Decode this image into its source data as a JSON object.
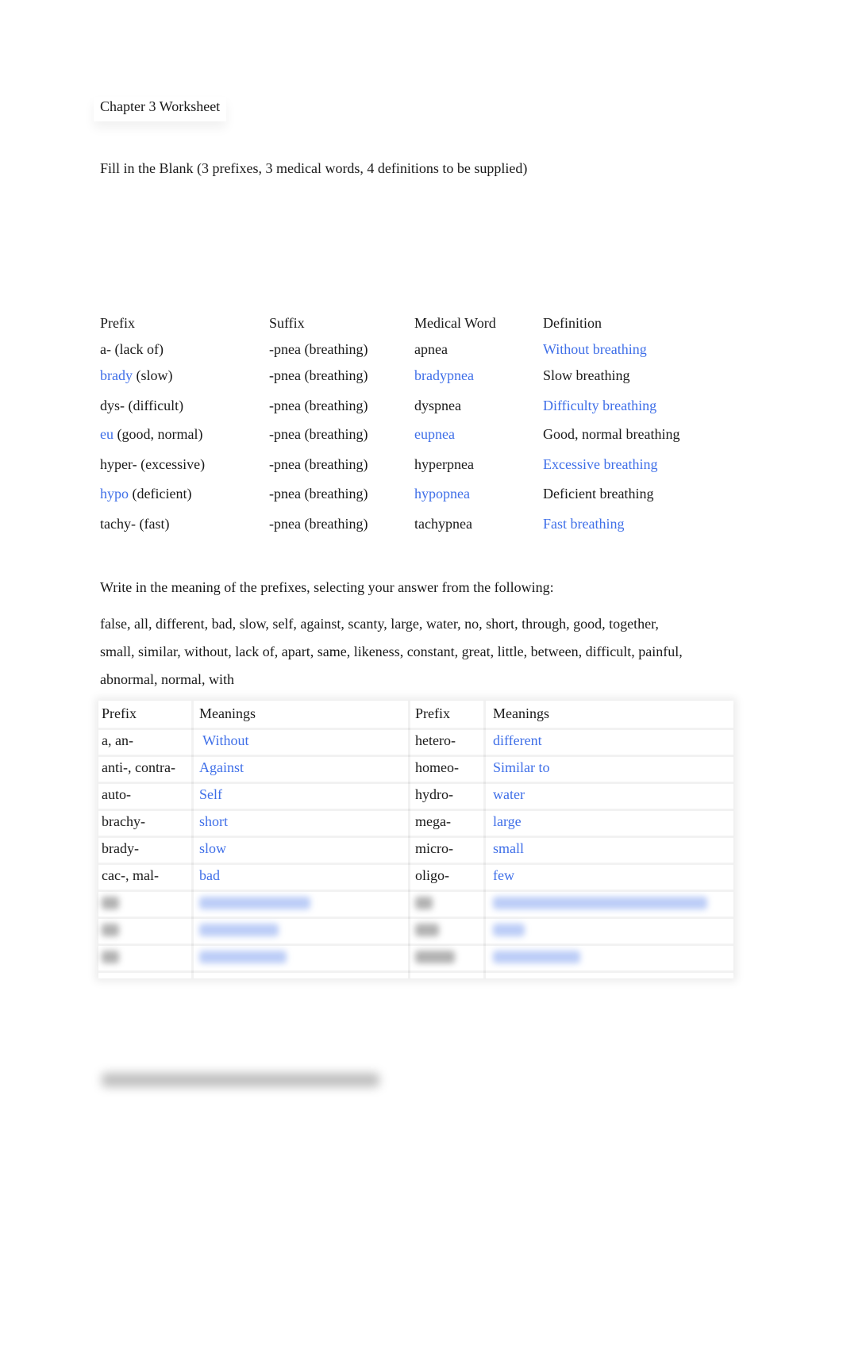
{
  "document": {
    "title": "Chapter 3 Worksheet",
    "instructions": "Fill in the Blank (3 prefixes, 3 medical words, 4 definitions to be supplied)"
  },
  "colors": {
    "answer": "#3f6fe8",
    "text": "#1a1a1a"
  },
  "fill_table": {
    "headers": [
      "Prefix",
      "Suffix",
      "Medical Word",
      "Definition"
    ],
    "rows": [
      {
        "prefix_answer": "",
        "prefix_text": "a- (lack of)",
        "suffix": "-pnea (breathing)",
        "word": "apnea",
        "word_is_answer": false,
        "definition": "Without breathing",
        "definition_is_answer": true
      },
      {
        "prefix_answer": "brady",
        "prefix_text": " (slow)",
        "suffix": "-pnea (breathing)",
        "word": "bradypnea",
        "word_is_answer": true,
        "definition": "Slow breathing",
        "definition_is_answer": false
      },
      {
        "prefix_answer": "",
        "prefix_text": "dys- (difficult)",
        "suffix": "-pnea (breathing)",
        "word": "dyspnea",
        "word_is_answer": false,
        "definition": "Difficulty breathing",
        "definition_is_answer": true
      },
      {
        "prefix_answer": "eu",
        "prefix_text": " (good, normal)",
        "suffix": "-pnea (breathing)",
        "word": "eupnea",
        "word_is_answer": true,
        "definition": "Good, normal breathing",
        "definition_is_answer": false
      },
      {
        "prefix_answer": "",
        "prefix_text": "hyper- (excessive)",
        "suffix": "-pnea (breathing)",
        "word": "hyperpnea",
        "word_is_answer": false,
        "definition": "Excessive breathing",
        "definition_is_answer": true
      },
      {
        "prefix_answer": "hypo",
        "prefix_text": " (deficient)",
        "suffix": "-pnea (breathing)",
        "word": "hypopnea",
        "word_is_answer": true,
        "definition": "Deficient breathing",
        "definition_is_answer": false
      },
      {
        "prefix_answer": "",
        "prefix_text": "tachy- (fast)",
        "suffix": "-pnea (breathing)",
        "word": "tachypnea",
        "word_is_answer": false,
        "definition": "Fast breathing",
        "definition_is_answer": true
      }
    ]
  },
  "meaning_section": {
    "instructions": "Write in the meaning of the prefixes, selecting your answer from the following:",
    "word_bank_lines": [
      "false, all, different, bad, slow, self, against, scanty, large, water, no, short, through, good, together,",
      "small, similar, without, lack of, apart, same, likeness, constant, great, little, between, difficult, painful,",
      "abnormal, normal, with"
    ]
  },
  "meaning_table": {
    "headers": [
      "Prefix",
      "Meanings",
      "Prefix",
      "Meanings"
    ],
    "rows": [
      {
        "prefix1": "a, an-",
        "meaning1": " Without",
        "prefix2": "hetero-",
        "meaning2": "different"
      },
      {
        "prefix1": "anti-, contra-",
        "meaning1": "Against",
        "prefix2": "homeo-",
        "meaning2": "Similar to"
      },
      {
        "prefix1": "auto-",
        "meaning1": "Self",
        "prefix2": "hydro-",
        "meaning2": "water"
      },
      {
        "prefix1": "brachy-",
        "meaning1": "short",
        "prefix2": "mega-",
        "meaning2": "large"
      },
      {
        "prefix1": "brady-",
        "meaning1": "slow",
        "prefix2": "micro-",
        "meaning2": "small"
      },
      {
        "prefix1": "cac-, mal-",
        "meaning1": "bad",
        "prefix2": "oligo-",
        "meaning2": "few"
      }
    ],
    "obscured_row_count": 3
  }
}
